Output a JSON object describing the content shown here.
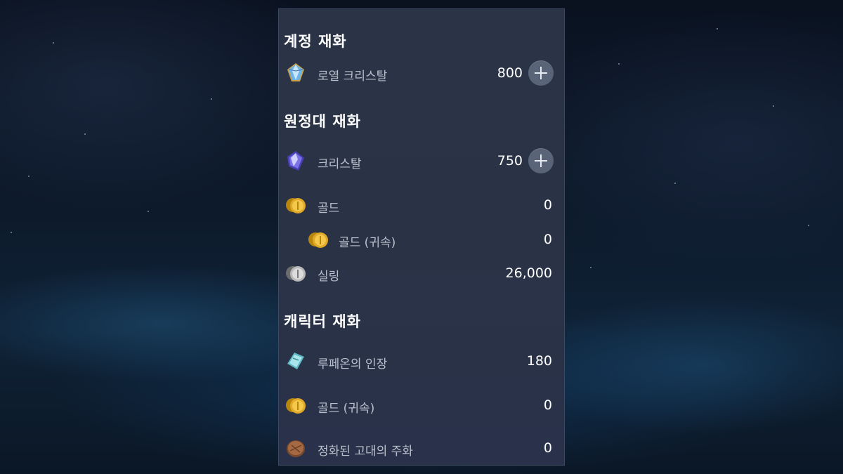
{
  "sections": {
    "account": {
      "title": "계정 재화",
      "items": [
        {
          "label": "로열 크리스탈",
          "value": "800",
          "icon": "royal-crystal-icon"
        }
      ]
    },
    "roster": {
      "title": "원정대 재화",
      "items": [
        {
          "label": "크리스탈",
          "value": "750",
          "icon": "crystal-icon"
        },
        {
          "label": "골드",
          "value": "0",
          "icon": "gold-coin-icon"
        },
        {
          "label": "골드 (귀속)",
          "value": "0",
          "icon": "bound-gold-coin-icon"
        },
        {
          "label": "실링",
          "value": "26,000",
          "icon": "silver-coin-icon"
        }
      ]
    },
    "character": {
      "title": "캐릭터 재화",
      "items": [
        {
          "label": "루페온의 인장",
          "value": "180",
          "icon": "lufeon-seal-icon"
        },
        {
          "label": "골드 (귀속)",
          "value": "0",
          "icon": "bound-gold-coin-icon"
        },
        {
          "label": "정화된 고대의 주화",
          "value": "0",
          "icon": "ancient-coin-icon"
        }
      ]
    }
  },
  "colors": {
    "panel_bg": "#2a3346",
    "label_text": "#b9c0cc",
    "value_text": "#ffffff",
    "button_bg": "#5a6478"
  }
}
